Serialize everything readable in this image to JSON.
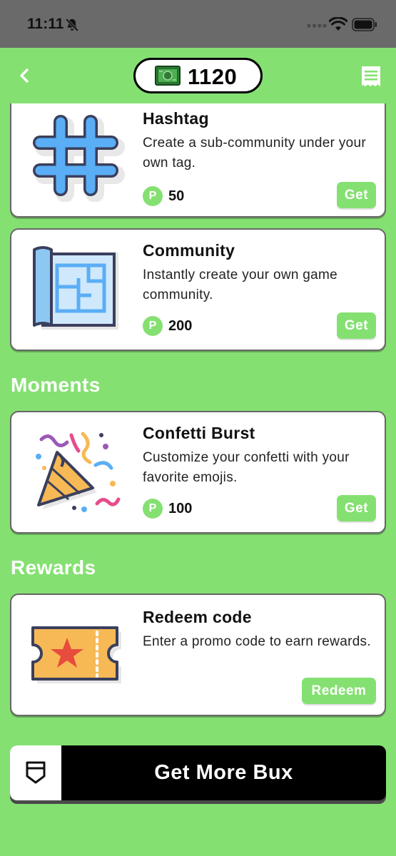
{
  "status_bar": {
    "time": "11:11"
  },
  "header": {
    "balance": "1120"
  },
  "items": [
    {
      "title": "Hashtag",
      "description": "Create a sub-community under your own tag.",
      "price_icon": "P",
      "price": "50",
      "button": "Get"
    },
    {
      "title": "Community",
      "description": "Instantly create your own game community.",
      "price_icon": "P",
      "price": "200",
      "button": "Get"
    }
  ],
  "moments": {
    "heading": "Moments",
    "items": [
      {
        "title": "Confetti Burst",
        "description": "Customize your confetti with your favorite emojis.",
        "price_icon": "P",
        "price": "100",
        "button": "Get"
      }
    ]
  },
  "rewards": {
    "heading": "Rewards",
    "items": [
      {
        "title": "Redeem code",
        "description": "Enter a promo code to earn rewards.",
        "button": "Redeem"
      }
    ]
  },
  "footer": {
    "label": "Get More Bux"
  },
  "colors": {
    "accent": "#85e072",
    "status_bar": "#6a6a6a",
    "card_border": "#666666"
  },
  "icons": [
    "bell-slash-icon",
    "cellular-dots-icon",
    "wifi-icon",
    "battery-icon",
    "back-chevron-icon",
    "money-bill-icon",
    "receipt-icon",
    "hashtag-icon",
    "blueprint-icon",
    "party-popper-icon",
    "ticket-icon",
    "shield-icon",
    "p-coin-icon"
  ]
}
